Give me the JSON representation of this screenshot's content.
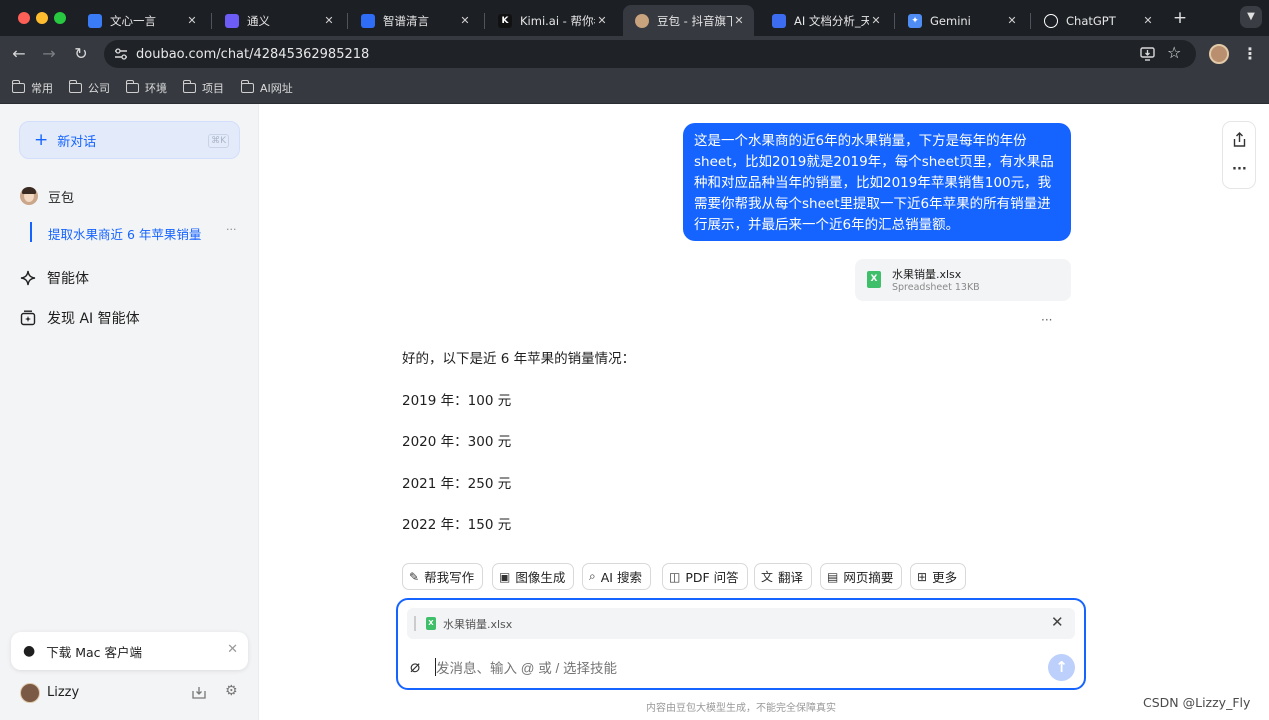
{
  "browser": {
    "tabs": [
      {
        "title": "文心一言",
        "fav_color": "#3a7bf6",
        "icon": "wenxin-icon",
        "active": false
      },
      {
        "title": "通义",
        "fav_color": "#6d5cf6",
        "icon": "tongyi-icon",
        "active": false
      },
      {
        "title": "智谱清言",
        "fav_color": "#2f6df6",
        "icon": "zhipu-icon",
        "active": false
      },
      {
        "title": "Kimi.ai - 帮你看",
        "fav_color": "#111111",
        "icon": "kimi-icon",
        "fav_text": "K",
        "active": false
      },
      {
        "title": "豆包 - 抖音旗下",
        "fav_color": "#c9a27e",
        "icon": "doubao-avatar-icon",
        "active": true
      },
      {
        "title": "AI 文档分析_天",
        "fav_color": "#3c6cf0",
        "icon": "doc-analysis-icon",
        "active": false
      },
      {
        "title": "Gemini",
        "fav_color": "#4f8df5",
        "icon": "gemini-icon",
        "fav_text": "✦",
        "active": false
      },
      {
        "title": "ChatGPT",
        "fav_color": "#e8e8e8",
        "icon": "chatgpt-icon",
        "active": false
      }
    ],
    "new_tab": "+",
    "url": "doubao.com/chat/42845362985218",
    "bookmarks": [
      "常用",
      "公司",
      "环境",
      "项目",
      "AI网址"
    ]
  },
  "sidebar": {
    "new_chat_label": "新对话",
    "new_chat_shortcut": "⌘K",
    "bot_name": "豆包",
    "active_chat": "提取水果商近 6 年苹果销量",
    "active_chat_more": "···",
    "nav_items": [
      {
        "label": "智能体",
        "icon": "sparkle-icon"
      },
      {
        "label": "发现 AI 智能体",
        "icon": "discover-icon"
      }
    ],
    "download_label": "下载 Mac 客户端",
    "user_name": "Lizzy"
  },
  "chat": {
    "user_message": "这是一个水果商的近6年的水果销量，下方是每年的年份sheet，比如2019就是2019年，每个sheet页里，有水果品种和对应品种当年的销量，比如2019年苹果销售100元，我需要你帮我从每个sheet里提取一下近6年苹果的所有销量进行展示，并最后来一个近6年的汇总销量额。",
    "file": {
      "name": "水果销量.xlsx",
      "meta": "Spreadsheet 13KB"
    },
    "more": "···",
    "answer_intro": "好的，以下是近 6 年苹果的销量情况：",
    "answer_lines": [
      "2019 年：100 元",
      "2020 年：300 元",
      "2021 年：250 元",
      "2022 年：150 元"
    ]
  },
  "skills": [
    {
      "label": "帮我写作",
      "icon": "pen-icon",
      "glyph": "✎"
    },
    {
      "label": "图像生成",
      "icon": "image-icon",
      "glyph": "▣"
    },
    {
      "label": "AI 搜索",
      "icon": "search-icon",
      "glyph": "⌕"
    },
    {
      "label": "PDF 问答",
      "icon": "book-icon",
      "glyph": "◫"
    },
    {
      "label": "翻译",
      "icon": "translate-icon",
      "glyph": "文"
    },
    {
      "label": "网页摘要",
      "icon": "webpage-icon",
      "glyph": "▤"
    },
    {
      "label": "更多",
      "icon": "grid-more-icon",
      "glyph": "⊞"
    }
  ],
  "input": {
    "attached_file": "水果销量.xlsx",
    "placeholder": "发消息、输入 @ 或 / 选择技能"
  },
  "footer": {
    "disclaimer": "内容由豆包大模型生成，不能完全保障真实",
    "watermark": "CSDN @Lizzy_Fly"
  }
}
